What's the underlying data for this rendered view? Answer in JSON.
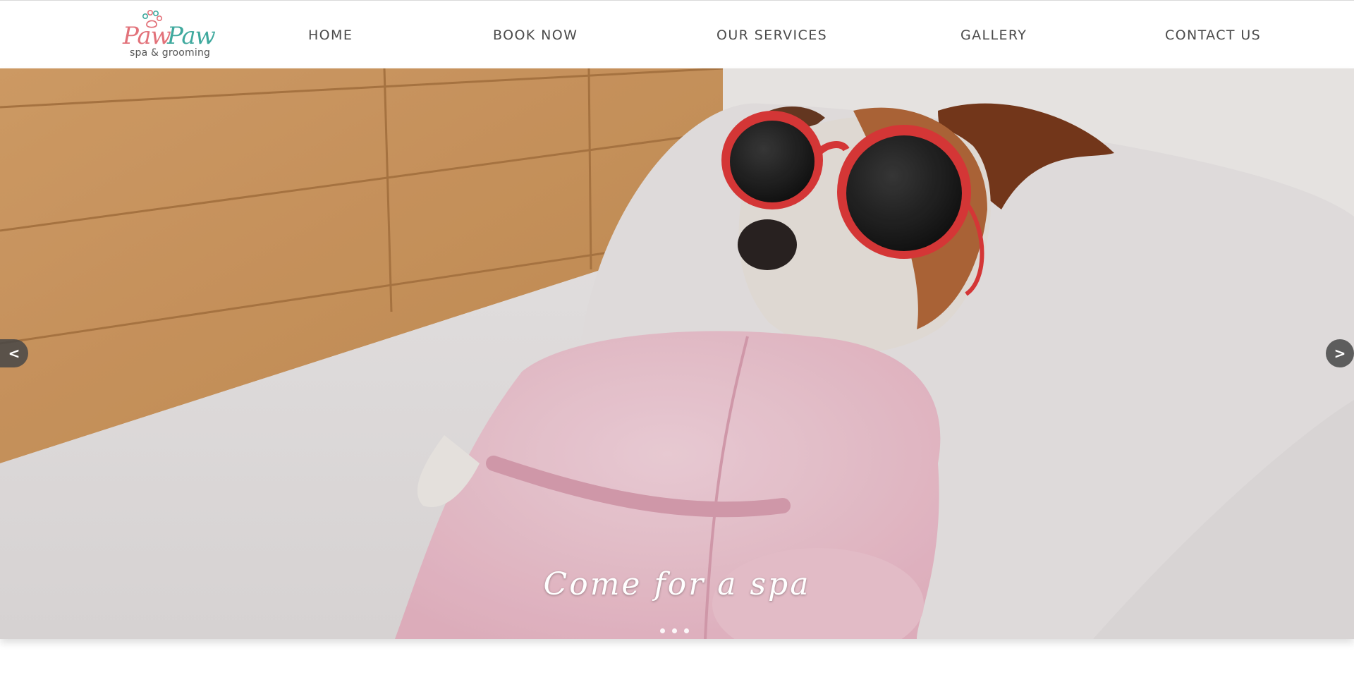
{
  "brand": {
    "name_part1": "Paw",
    "name_part2": "Paw",
    "tagline": "spa & grooming",
    "color_primary": "#e2727a",
    "color_secondary": "#3fa99e"
  },
  "nav": {
    "items": [
      {
        "label": "HOME"
      },
      {
        "label": "BOOK NOW"
      },
      {
        "label": "OUR SERVICES"
      },
      {
        "label": "GALLERY"
      },
      {
        "label": "CONTACT US"
      }
    ]
  },
  "hero": {
    "image_subject": "dog-in-pink-bathrobe-with-red-sunglasses",
    "caption": "Come for a spa",
    "prev_label": "<",
    "next_label": ">",
    "slide_count": 3,
    "active_slide": 1
  }
}
